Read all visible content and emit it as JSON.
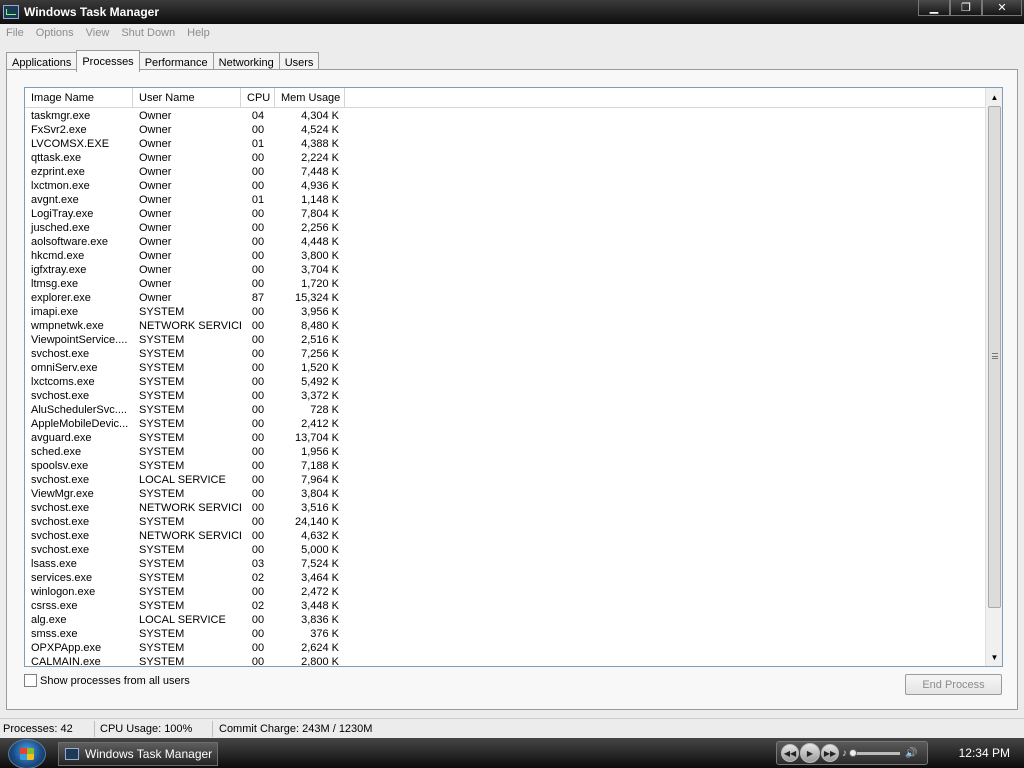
{
  "window": {
    "title": "Windows Task Manager"
  },
  "menu": [
    "File",
    "Options",
    "View",
    "Shut Down",
    "Help"
  ],
  "tabs": [
    {
      "label": "Applications"
    },
    {
      "label": "Processes",
      "active": true
    },
    {
      "label": "Performance"
    },
    {
      "label": "Networking"
    },
    {
      "label": "Users"
    }
  ],
  "columns": {
    "image_name": "Image Name",
    "user_name": "User Name",
    "cpu": "CPU",
    "mem": "Mem Usage"
  },
  "processes": [
    {
      "name": "taskmgr.exe",
      "user": "Owner",
      "cpu": "04",
      "mem": "4,304 K"
    },
    {
      "name": "FxSvr2.exe",
      "user": "Owner",
      "cpu": "00",
      "mem": "4,524 K"
    },
    {
      "name": "LVCOMSX.EXE",
      "user": "Owner",
      "cpu": "01",
      "mem": "4,388 K"
    },
    {
      "name": "qttask.exe",
      "user": "Owner",
      "cpu": "00",
      "mem": "2,224 K"
    },
    {
      "name": "ezprint.exe",
      "user": "Owner",
      "cpu": "00",
      "mem": "7,448 K"
    },
    {
      "name": "lxctmon.exe",
      "user": "Owner",
      "cpu": "00",
      "mem": "4,936 K"
    },
    {
      "name": "avgnt.exe",
      "user": "Owner",
      "cpu": "01",
      "mem": "1,148 K"
    },
    {
      "name": "LogiTray.exe",
      "user": "Owner",
      "cpu": "00",
      "mem": "7,804 K"
    },
    {
      "name": "jusched.exe",
      "user": "Owner",
      "cpu": "00",
      "mem": "2,256 K"
    },
    {
      "name": "aolsoftware.exe",
      "user": "Owner",
      "cpu": "00",
      "mem": "4,448 K"
    },
    {
      "name": "hkcmd.exe",
      "user": "Owner",
      "cpu": "00",
      "mem": "3,800 K"
    },
    {
      "name": "igfxtray.exe",
      "user": "Owner",
      "cpu": "00",
      "mem": "3,704 K"
    },
    {
      "name": "ltmsg.exe",
      "user": "Owner",
      "cpu": "00",
      "mem": "1,720 K"
    },
    {
      "name": "explorer.exe",
      "user": "Owner",
      "cpu": "87",
      "mem": "15,324 K"
    },
    {
      "name": "imapi.exe",
      "user": "SYSTEM",
      "cpu": "00",
      "mem": "3,956 K"
    },
    {
      "name": "wmpnetwk.exe",
      "user": "NETWORK SERVICE",
      "cpu": "00",
      "mem": "8,480 K"
    },
    {
      "name": "ViewpointService....",
      "user": "SYSTEM",
      "cpu": "00",
      "mem": "2,516 K"
    },
    {
      "name": "svchost.exe",
      "user": "SYSTEM",
      "cpu": "00",
      "mem": "7,256 K"
    },
    {
      "name": "omniServ.exe",
      "user": "SYSTEM",
      "cpu": "00",
      "mem": "1,520 K"
    },
    {
      "name": "lxctcoms.exe",
      "user": "SYSTEM",
      "cpu": "00",
      "mem": "5,492 K"
    },
    {
      "name": "svchost.exe",
      "user": "SYSTEM",
      "cpu": "00",
      "mem": "3,372 K"
    },
    {
      "name": "AluSchedulerSvc....",
      "user": "SYSTEM",
      "cpu": "00",
      "mem": "728 K"
    },
    {
      "name": "AppleMobileDevic...",
      "user": "SYSTEM",
      "cpu": "00",
      "mem": "2,412 K"
    },
    {
      "name": "avguard.exe",
      "user": "SYSTEM",
      "cpu": "00",
      "mem": "13,704 K"
    },
    {
      "name": "sched.exe",
      "user": "SYSTEM",
      "cpu": "00",
      "mem": "1,956 K"
    },
    {
      "name": "spoolsv.exe",
      "user": "SYSTEM",
      "cpu": "00",
      "mem": "7,188 K"
    },
    {
      "name": "svchost.exe",
      "user": "LOCAL SERVICE",
      "cpu": "00",
      "mem": "7,964 K"
    },
    {
      "name": "ViewMgr.exe",
      "user": "SYSTEM",
      "cpu": "00",
      "mem": "3,804 K"
    },
    {
      "name": "svchost.exe",
      "user": "NETWORK SERVICE",
      "cpu": "00",
      "mem": "3,516 K"
    },
    {
      "name": "svchost.exe",
      "user": "SYSTEM",
      "cpu": "00",
      "mem": "24,140 K"
    },
    {
      "name": "svchost.exe",
      "user": "NETWORK SERVICE",
      "cpu": "00",
      "mem": "4,632 K"
    },
    {
      "name": "svchost.exe",
      "user": "SYSTEM",
      "cpu": "00",
      "mem": "5,000 K"
    },
    {
      "name": "lsass.exe",
      "user": "SYSTEM",
      "cpu": "03",
      "mem": "7,524 K"
    },
    {
      "name": "services.exe",
      "user": "SYSTEM",
      "cpu": "02",
      "mem": "3,464 K"
    },
    {
      "name": "winlogon.exe",
      "user": "SYSTEM",
      "cpu": "00",
      "mem": "2,472 K"
    },
    {
      "name": "csrss.exe",
      "user": "SYSTEM",
      "cpu": "02",
      "mem": "3,448 K"
    },
    {
      "name": "alg.exe",
      "user": "LOCAL SERVICE",
      "cpu": "00",
      "mem": "3,836 K"
    },
    {
      "name": "smss.exe",
      "user": "SYSTEM",
      "cpu": "00",
      "mem": "376 K"
    },
    {
      "name": "OPXPApp.exe",
      "user": "SYSTEM",
      "cpu": "00",
      "mem": "2,624 K"
    },
    {
      "name": "CALMAIN.exe",
      "user": "SYSTEM",
      "cpu": "00",
      "mem": "2,800 K"
    }
  ],
  "show_all": {
    "label": "Show processes from all users",
    "checked": false
  },
  "end_process": {
    "label": "End Process",
    "enabled": false
  },
  "status": {
    "processes": "Processes: 42",
    "cpu": "CPU Usage: 100%",
    "commit": "Commit Charge: 243M / 1230M"
  },
  "taskbar": {
    "task_label": "Windows Task Manager",
    "clock": "12:34 PM"
  },
  "icons": [
    "app-icon",
    "minimize-icon",
    "restore-icon",
    "close-icon",
    "scroll-up-icon",
    "scroll-down-icon",
    "start-icon",
    "previous-track-icon",
    "play-icon",
    "next-track-icon",
    "volume-icon"
  ]
}
